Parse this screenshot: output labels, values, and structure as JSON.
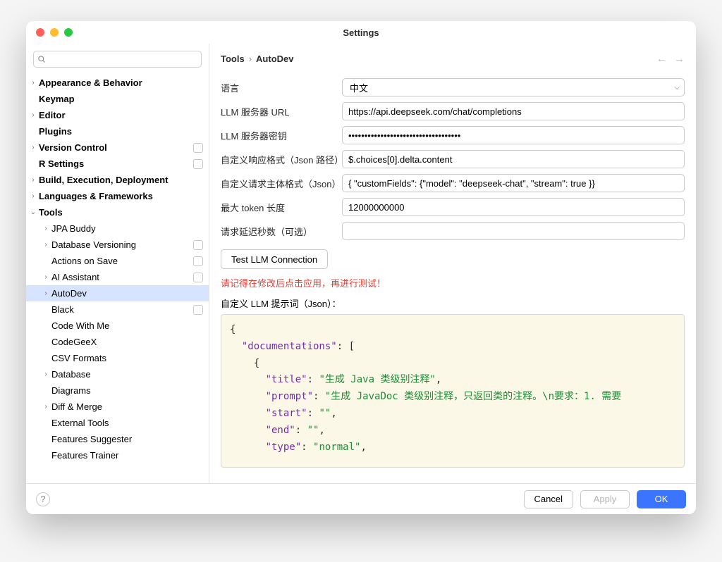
{
  "window": {
    "title": "Settings"
  },
  "search": {
    "placeholder": ""
  },
  "sidebar": {
    "items": [
      {
        "label": "Appearance & Behavior",
        "bold": true,
        "indent": 0,
        "chevron": "right",
        "badge": false
      },
      {
        "label": "Keymap",
        "bold": true,
        "indent": 0,
        "chevron": "",
        "badge": false
      },
      {
        "label": "Editor",
        "bold": true,
        "indent": 0,
        "chevron": "right",
        "badge": false
      },
      {
        "label": "Plugins",
        "bold": true,
        "indent": 0,
        "chevron": "",
        "badge": false
      },
      {
        "label": "Version Control",
        "bold": true,
        "indent": 0,
        "chevron": "right",
        "badge": true
      },
      {
        "label": "R Settings",
        "bold": true,
        "indent": 0,
        "chevron": "",
        "badge": true
      },
      {
        "label": "Build, Execution, Deployment",
        "bold": true,
        "indent": 0,
        "chevron": "right",
        "badge": false
      },
      {
        "label": "Languages & Frameworks",
        "bold": true,
        "indent": 0,
        "chevron": "right",
        "badge": false
      },
      {
        "label": "Tools",
        "bold": true,
        "indent": 0,
        "chevron": "down",
        "badge": false
      },
      {
        "label": "JPA Buddy",
        "bold": false,
        "indent": 1,
        "chevron": "right",
        "badge": false
      },
      {
        "label": "Database Versioning",
        "bold": false,
        "indent": 1,
        "chevron": "right",
        "badge": true
      },
      {
        "label": "Actions on Save",
        "bold": false,
        "indent": 1,
        "chevron": "",
        "badge": true
      },
      {
        "label": "AI Assistant",
        "bold": false,
        "indent": 1,
        "chevron": "right",
        "badge": true
      },
      {
        "label": "AutoDev",
        "bold": false,
        "indent": 1,
        "chevron": "right",
        "badge": false,
        "selected": true
      },
      {
        "label": "Black",
        "bold": false,
        "indent": 1,
        "chevron": "",
        "badge": true
      },
      {
        "label": "Code With Me",
        "bold": false,
        "indent": 1,
        "chevron": "",
        "badge": false
      },
      {
        "label": "CodeGeeX",
        "bold": false,
        "indent": 1,
        "chevron": "",
        "badge": false
      },
      {
        "label": "CSV Formats",
        "bold": false,
        "indent": 1,
        "chevron": "",
        "badge": false
      },
      {
        "label": "Database",
        "bold": false,
        "indent": 1,
        "chevron": "right",
        "badge": false
      },
      {
        "label": "Diagrams",
        "bold": false,
        "indent": 1,
        "chevron": "",
        "badge": false
      },
      {
        "label": "Diff & Merge",
        "bold": false,
        "indent": 1,
        "chevron": "right",
        "badge": false
      },
      {
        "label": "External Tools",
        "bold": false,
        "indent": 1,
        "chevron": "",
        "badge": false
      },
      {
        "label": "Features Suggester",
        "bold": false,
        "indent": 1,
        "chevron": "",
        "badge": false
      },
      {
        "label": "Features Trainer",
        "bold": false,
        "indent": 1,
        "chevron": "",
        "badge": false
      }
    ]
  },
  "breadcrumb": {
    "root": "Tools",
    "sep": "›",
    "leaf": "AutoDev"
  },
  "form": {
    "language_label": "语言",
    "language_value": "中文",
    "server_url_label": "LLM 服务器 URL",
    "server_url_value": "https://api.deepseek.com/chat/completions",
    "server_key_label": "LLM 服务器密钥",
    "server_key_value": "•••••••••••••••••••••••••••••••••••",
    "resp_fmt_label": "自定义响应格式（Json 路径）",
    "resp_fmt_value": "$.choices[0].delta.content",
    "req_fmt_label": "自定义请求主体格式（Json）",
    "req_fmt_value": "{ \"customFields\": {\"model\": \"deepseek-chat\", \"stream\": true }}",
    "max_token_label": "最大 token 长度",
    "max_token_value": "12000000000",
    "delay_label": "请求延迟秒数（可选）",
    "delay_value": "",
    "test_btn": "Test LLM Connection",
    "warning": "请记得在修改后点击应用，再进行测试！",
    "prompt_label": "自定义 LLM 提示词（Json）：",
    "code": {
      "l1": "{",
      "docs_key": "\"documentations\"",
      "title_key": "\"title\"",
      "title_val": "\"生成 Java 类级别注释\"",
      "prompt_key": "\"prompt\"",
      "prompt_val": "\"生成 JavaDoc 类级别注释，只返回类的注释。\\n要求：1. 需要",
      "start_key": "\"start\"",
      "start_val": "\"\"",
      "end_key": "\"end\"",
      "end_val": "\"\"",
      "type_key": "\"type\"",
      "type_val": "\"normal\""
    }
  },
  "footer": {
    "help": "?",
    "cancel": "Cancel",
    "apply": "Apply",
    "ok": "OK"
  }
}
